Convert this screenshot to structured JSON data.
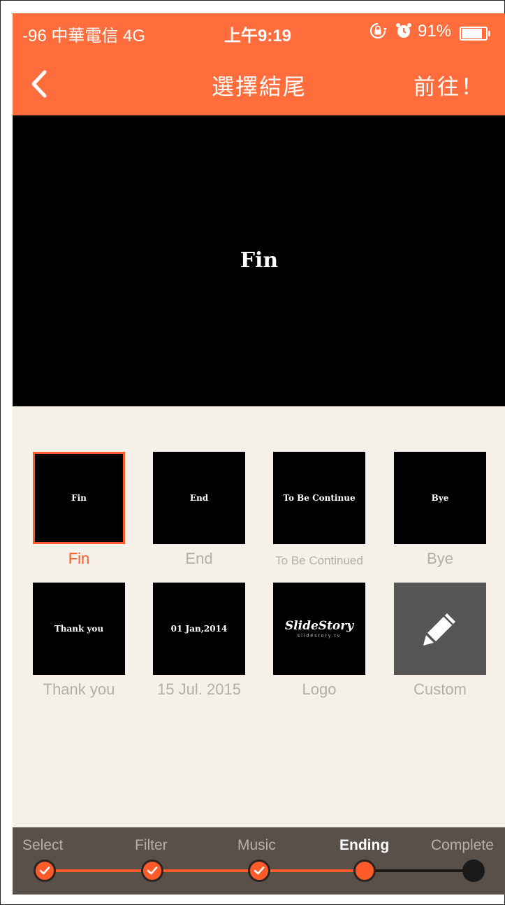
{
  "status_bar": {
    "carrier": "-96 中華電信  4G",
    "time": "上午9:19",
    "battery_percent": "91%",
    "battery_level": 0.91,
    "icons": [
      "rotation-lock-icon",
      "alarm-icon",
      "battery-icon"
    ]
  },
  "nav": {
    "back_icon": "chevron-left-icon",
    "title": "選擇結尾",
    "next_label": "前往！"
  },
  "preview": {
    "text": "Fin"
  },
  "endings": [
    {
      "thumb": "Fin",
      "label": "Fin",
      "selected": true
    },
    {
      "thumb": "End",
      "label": "End",
      "selected": false
    },
    {
      "thumb": "To Be Continue",
      "label": "To Be Continued",
      "selected": false
    },
    {
      "thumb": "Bye",
      "label": "Bye",
      "selected": false
    },
    {
      "thumb": "Thank you",
      "label": "Thank you",
      "selected": false
    },
    {
      "thumb": "01 Jan,2014",
      "label": "15 Jul. 2015",
      "selected": false
    },
    {
      "thumb": "SlideStory",
      "thumb_sub": "slidestory.tv",
      "label": "Logo",
      "selected": false
    },
    {
      "thumb_icon": "pencil-icon",
      "label": "Custom",
      "selected": false
    }
  ],
  "steps": [
    {
      "label": "Select",
      "state": "done"
    },
    {
      "label": "Filter",
      "state": "done"
    },
    {
      "label": "Music",
      "state": "done"
    },
    {
      "label": "Ending",
      "state": "current"
    },
    {
      "label": "Complete",
      "state": "todo"
    }
  ],
  "colors": {
    "accent": "#ff6d3c",
    "selected": "#ff5a2a",
    "background": "#f6f1e8",
    "muted_label": "#b3aea6",
    "steps_bg": "#5a504a"
  }
}
